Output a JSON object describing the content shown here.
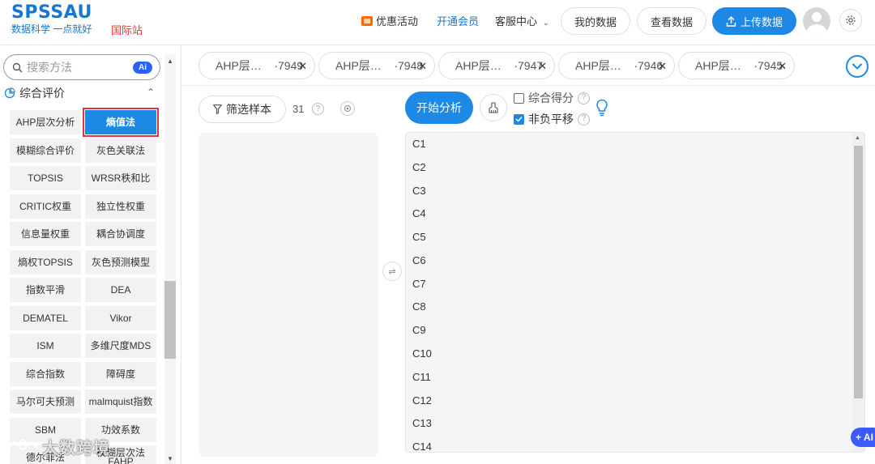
{
  "header": {
    "logo_main": "SPSSAU",
    "logo_sub": "数据科学 一点就好",
    "intl_link": "国际站",
    "promo": "优惠活动",
    "vip": "开通会员",
    "service": "客服中心",
    "my_data": "我的数据",
    "view_data": "查看数据",
    "upload": "上传数据"
  },
  "sidebar": {
    "search_placeholder": "搜索方法",
    "ai_badge": "Ai",
    "category": "综合评价",
    "methods": [
      "AHP层次分析",
      "熵值法",
      "模糊综合评价",
      "灰色关联法",
      "TOPSIS",
      "WRSR秩和比",
      "CRITIC权重",
      "独立性权重",
      "信息量权重",
      "耦合协调度",
      "熵权TOPSIS",
      "灰色预测模型",
      "指数平滑",
      "DEA",
      "DEMATEL",
      "Vikor",
      "ISM",
      "多维尺度MDS",
      "综合指数",
      "障碍度",
      "马尔可夫预测",
      "malmquist指数",
      "SBM",
      "功效系数",
      "德尔菲法",
      "模糊层次法FAHP"
    ],
    "active_method": "熵值法"
  },
  "tabs": [
    {
      "name": "AHP层…",
      "suffix": "·7949"
    },
    {
      "name": "AHP层…",
      "suffix": "·7948"
    },
    {
      "name": "AHP层…",
      "suffix": "·7947"
    },
    {
      "name": "AHP层…",
      "suffix": "·7946"
    },
    {
      "name": "AHP层…",
      "suffix": "·7945"
    }
  ],
  "toolbar": {
    "filter": "筛选样本",
    "sample_count": "31",
    "start": "开始分析",
    "option_score": "综合得分",
    "option_score_checked": false,
    "option_shift": "非负平移",
    "option_shift_checked": true
  },
  "variables": [
    "C1",
    "C2",
    "C3",
    "C4",
    "C5",
    "C6",
    "C7",
    "C8",
    "C9",
    "C10",
    "C11",
    "C12",
    "C13",
    "C14"
  ],
  "float": {
    "ai": "+ AI",
    "watermark": "大数跨境"
  },
  "colors": {
    "brand": "#1e88e5",
    "intl": "#e4393c",
    "active_outline": "#d9363e"
  }
}
